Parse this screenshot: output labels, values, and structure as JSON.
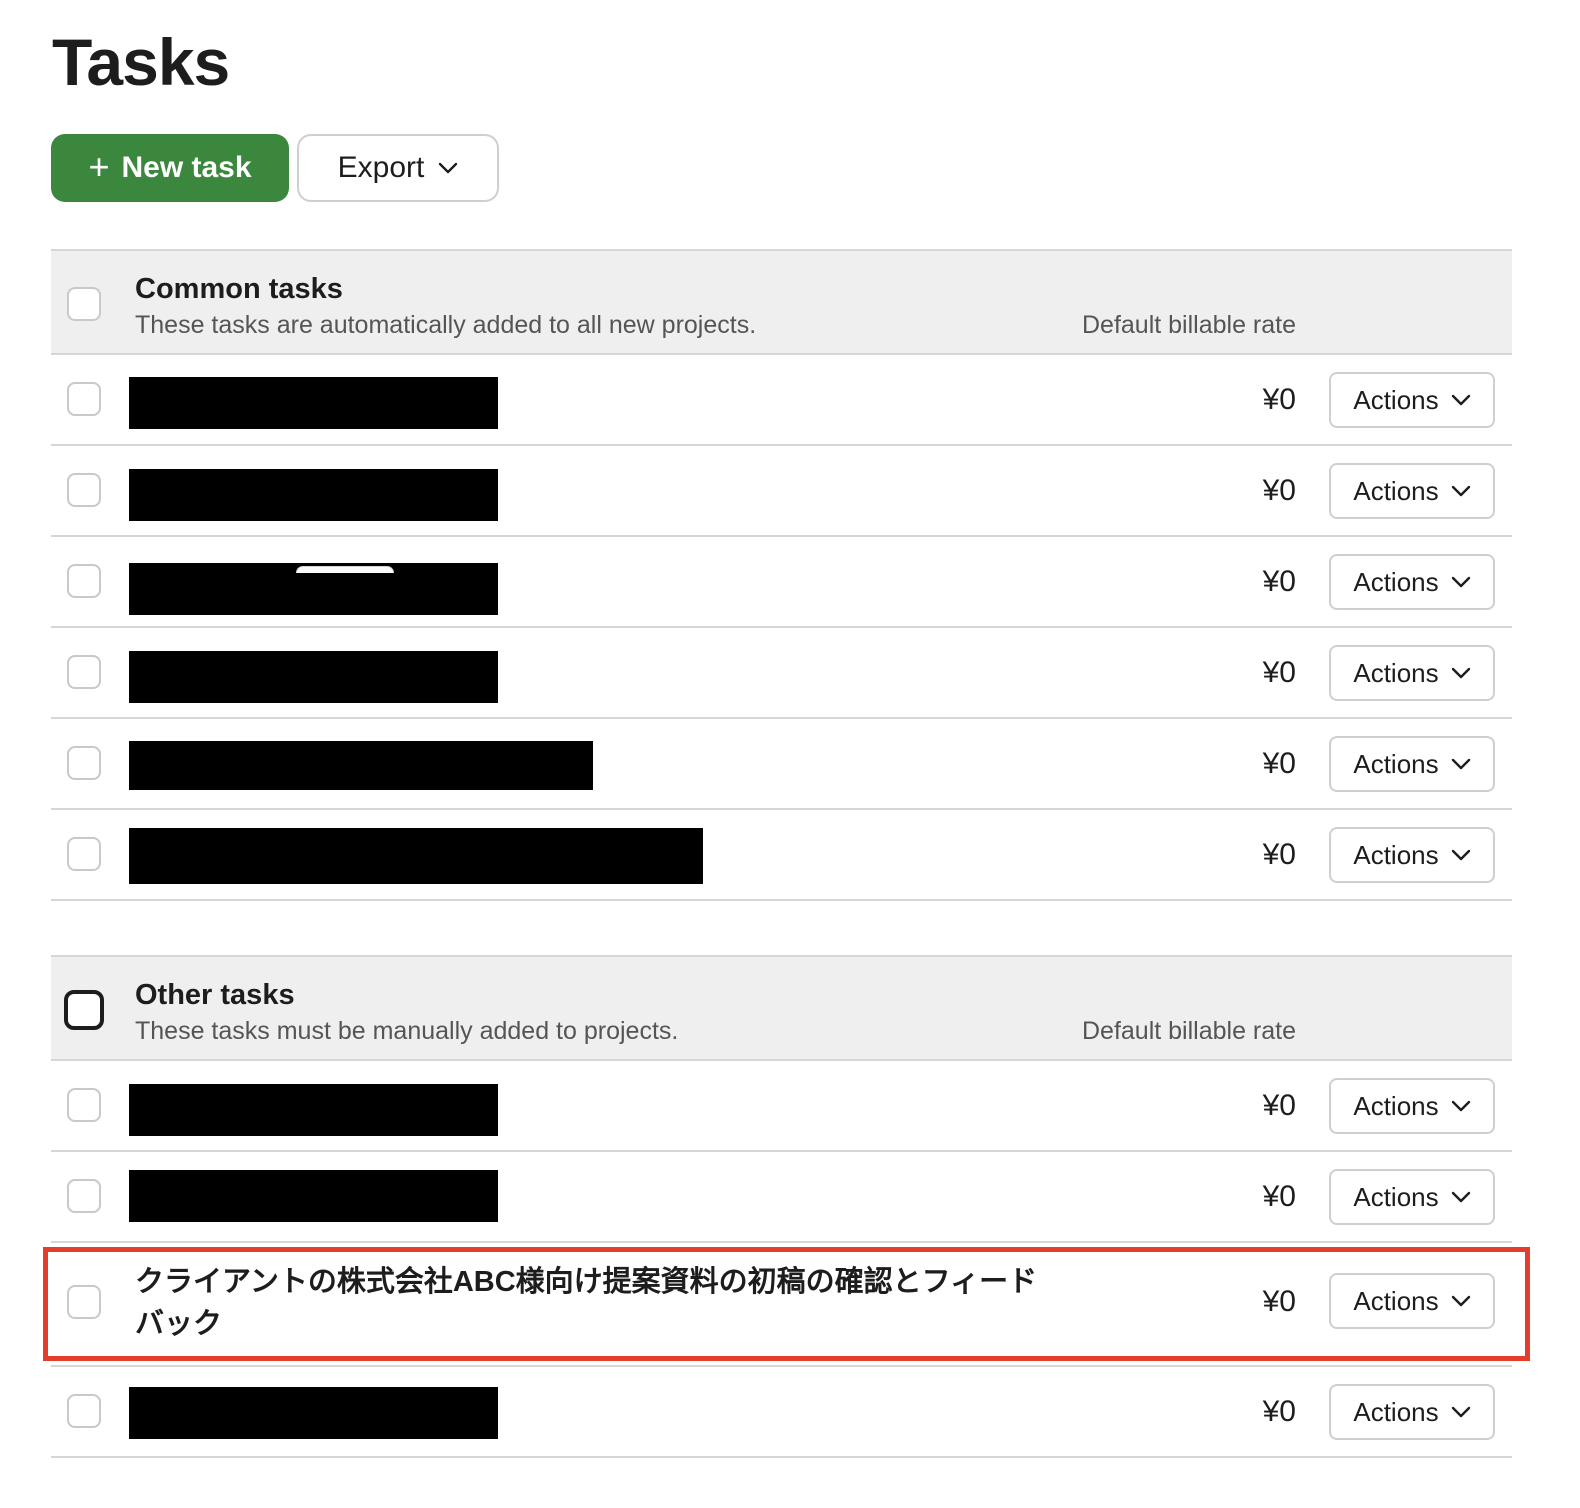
{
  "page": {
    "title": "Tasks"
  },
  "toolbar": {
    "new_task_label": "New task",
    "new_task_icon": "plus-icon",
    "export_label": "Export",
    "export_icon": "chevron-down-icon"
  },
  "colors": {
    "primary_button": "#3b873e",
    "highlight_border": "#e33e2b",
    "header_bg": "#efefef"
  },
  "common_tasks": {
    "title": "Common tasks",
    "description": "These tasks are automatically added to all new projects.",
    "rate_header": "Default billable rate",
    "rows": [
      {
        "name": "[redacted]",
        "rate": "¥0",
        "actions_label": "Actions"
      },
      {
        "name": "[redacted]",
        "rate": "¥0",
        "actions_label": "Actions"
      },
      {
        "name": "[redacted]",
        "rate": "¥0",
        "actions_label": "Actions"
      },
      {
        "name": "[redacted]",
        "rate": "¥0",
        "actions_label": "Actions"
      },
      {
        "name": "[redacted]",
        "rate": "¥0",
        "actions_label": "Actions"
      },
      {
        "name": "[redacted]",
        "rate": "¥0",
        "actions_label": "Actions"
      }
    ]
  },
  "other_tasks": {
    "title": "Other tasks",
    "description": "These tasks must be manually added to projects.",
    "rate_header": "Default billable rate",
    "rows": [
      {
        "name": "[redacted]",
        "rate": "¥0",
        "actions_label": "Actions"
      },
      {
        "name": "[redacted]",
        "rate": "¥0",
        "actions_label": "Actions"
      },
      {
        "name": "クライアントの株式会社ABC様向け提案資料の初稿の確認とフィードバック",
        "rate": "¥0",
        "actions_label": "Actions"
      },
      {
        "name": "[redacted]",
        "rate": "¥0",
        "actions_label": "Actions"
      }
    ]
  }
}
